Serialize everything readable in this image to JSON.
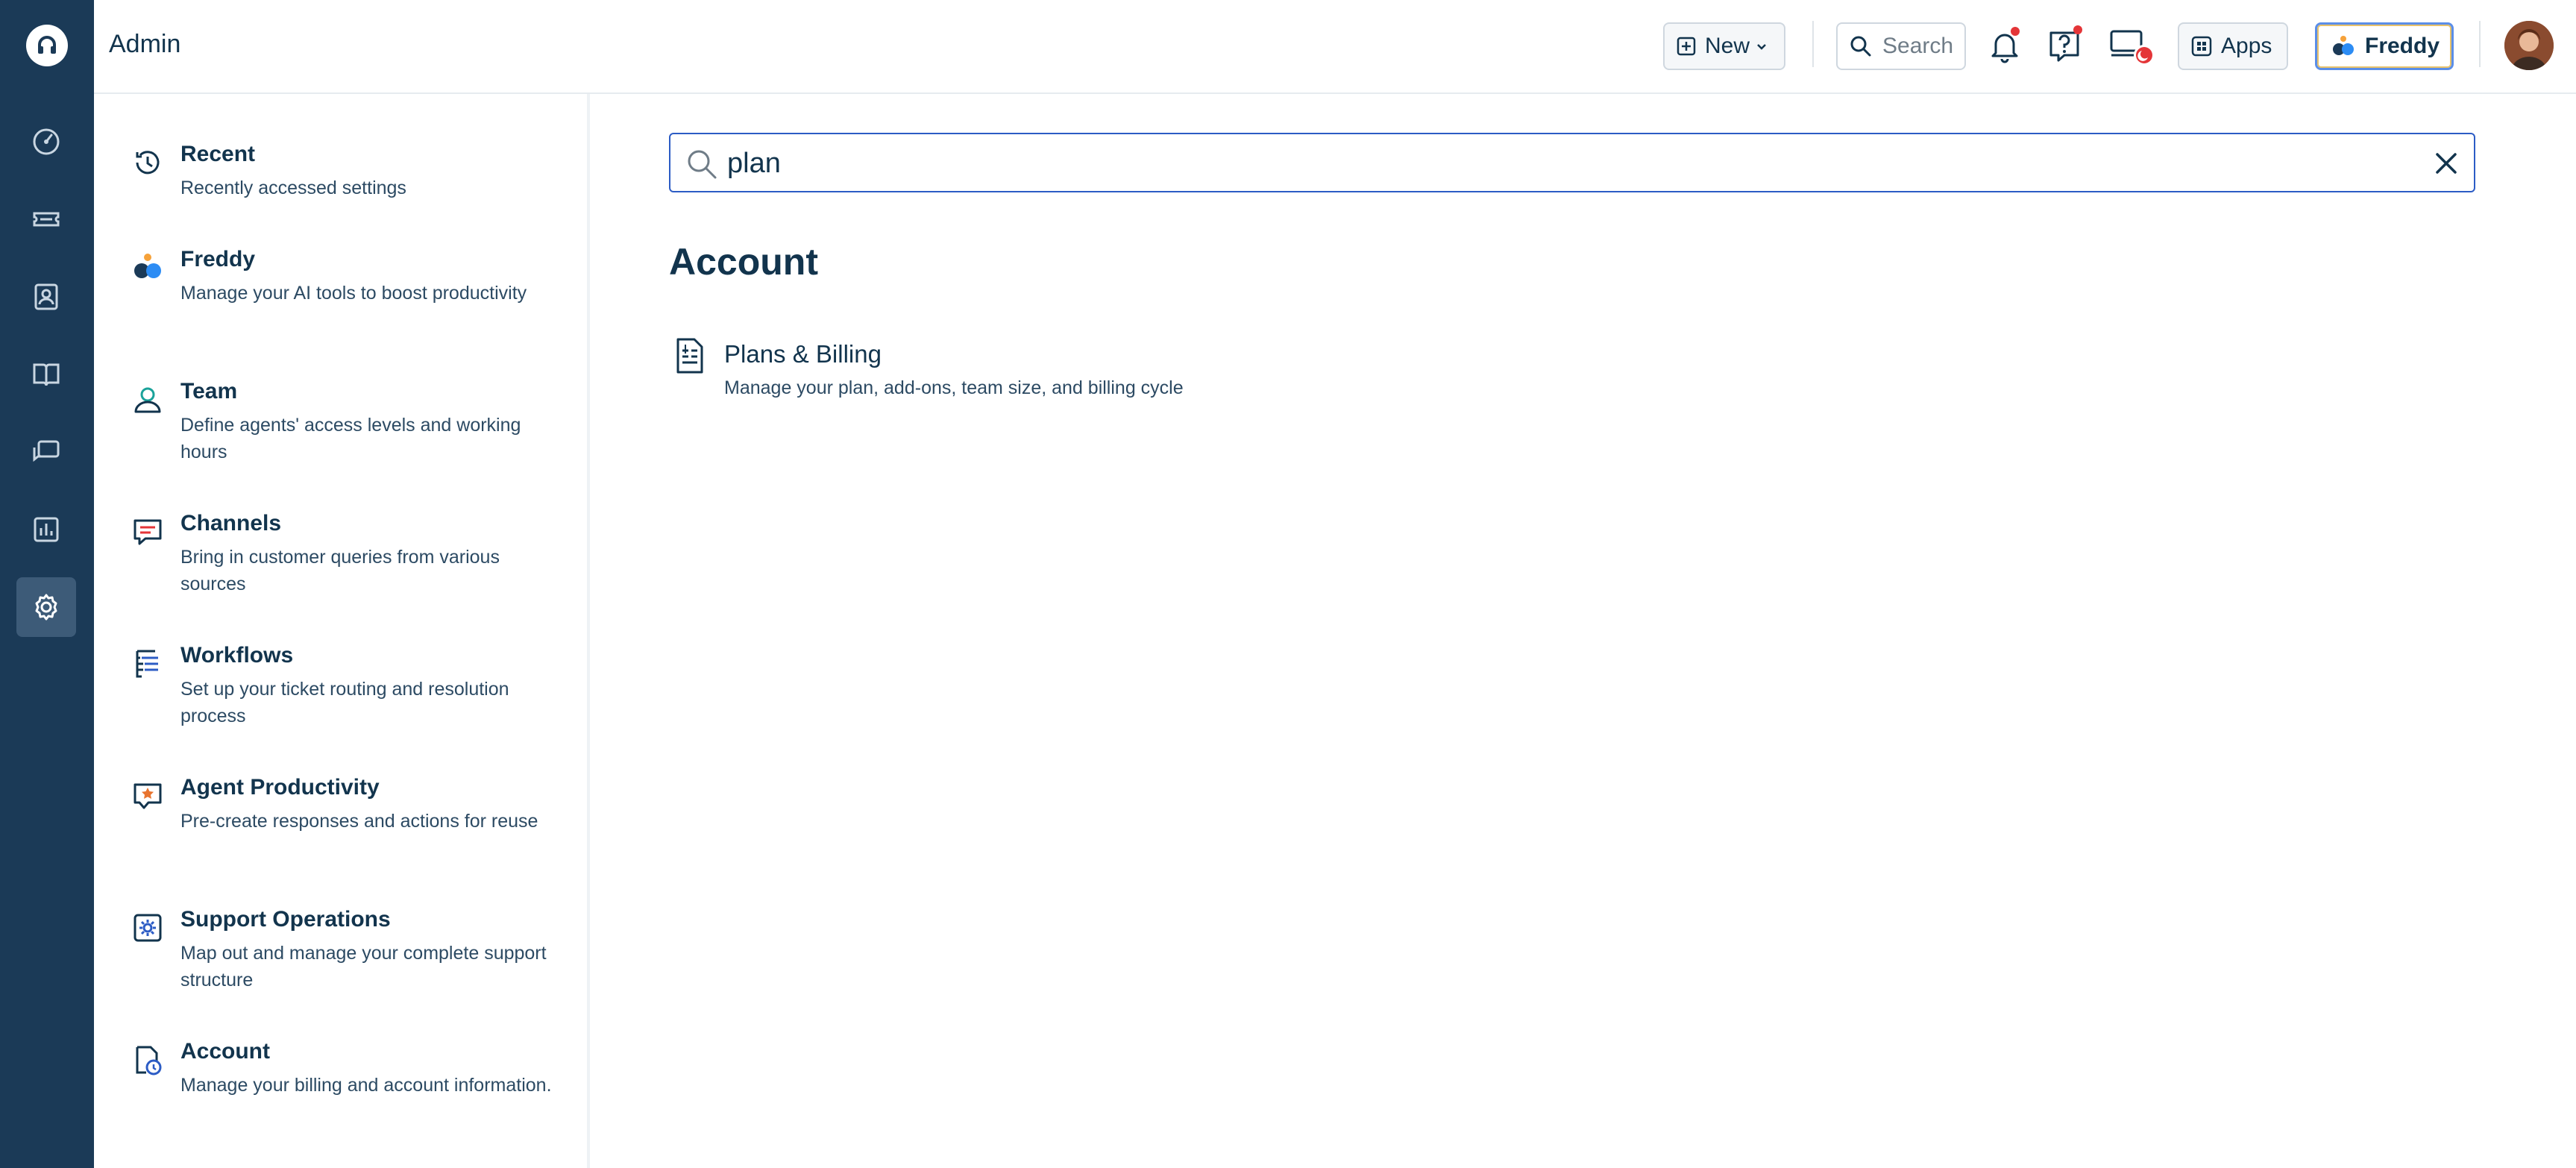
{
  "app": {
    "title": "Admin"
  },
  "topbar": {
    "new_label": "New",
    "search_placeholder": "Search",
    "apps_label": "Apps",
    "freddy_label": "Freddy"
  },
  "rail": {
    "items": [
      {
        "icon": "dashboard-icon"
      },
      {
        "icon": "tickets-icon"
      },
      {
        "icon": "contacts-icon"
      },
      {
        "icon": "knowledge-base-icon"
      },
      {
        "icon": "conversations-icon"
      },
      {
        "icon": "analytics-icon"
      },
      {
        "icon": "admin-gear-icon",
        "active": true
      }
    ]
  },
  "sidebar": {
    "items": [
      {
        "title": "Recent",
        "desc": "Recently accessed settings",
        "icon": "history-icon"
      },
      {
        "title": "Freddy",
        "desc": "Manage your AI tools to boost productivity",
        "icon": "freddy-ai-icon"
      },
      {
        "title": "Team",
        "desc": "Define agents' access levels and working hours",
        "icon": "team-icon"
      },
      {
        "title": "Channels",
        "desc": "Bring in customer queries from various sources",
        "icon": "channels-icon"
      },
      {
        "title": "Workflows",
        "desc": "Set up your ticket routing and resolution process",
        "icon": "workflows-icon"
      },
      {
        "title": "Agent Productivity",
        "desc": "Pre-create responses and actions for reuse",
        "icon": "agent-productivity-icon"
      },
      {
        "title": "Support Operations",
        "desc": "Map out and manage your complete support structure",
        "icon": "support-operations-icon"
      },
      {
        "title": "Account",
        "desc": "Manage your billing and account information.",
        "icon": "account-icon"
      }
    ]
  },
  "main": {
    "search_value": "plan",
    "section_title": "Account",
    "results": [
      {
        "title": "Plans & Billing",
        "desc": "Manage your plan, add-ons, team size, and billing cycle",
        "icon": "billing-document-icon"
      }
    ]
  },
  "colors": {
    "rail_bg": "#1b3a57",
    "rail_active": "#3d5b78",
    "text_primary": "#12344d",
    "search_border": "#2c5cc5",
    "notification_dot": "#e43538"
  }
}
